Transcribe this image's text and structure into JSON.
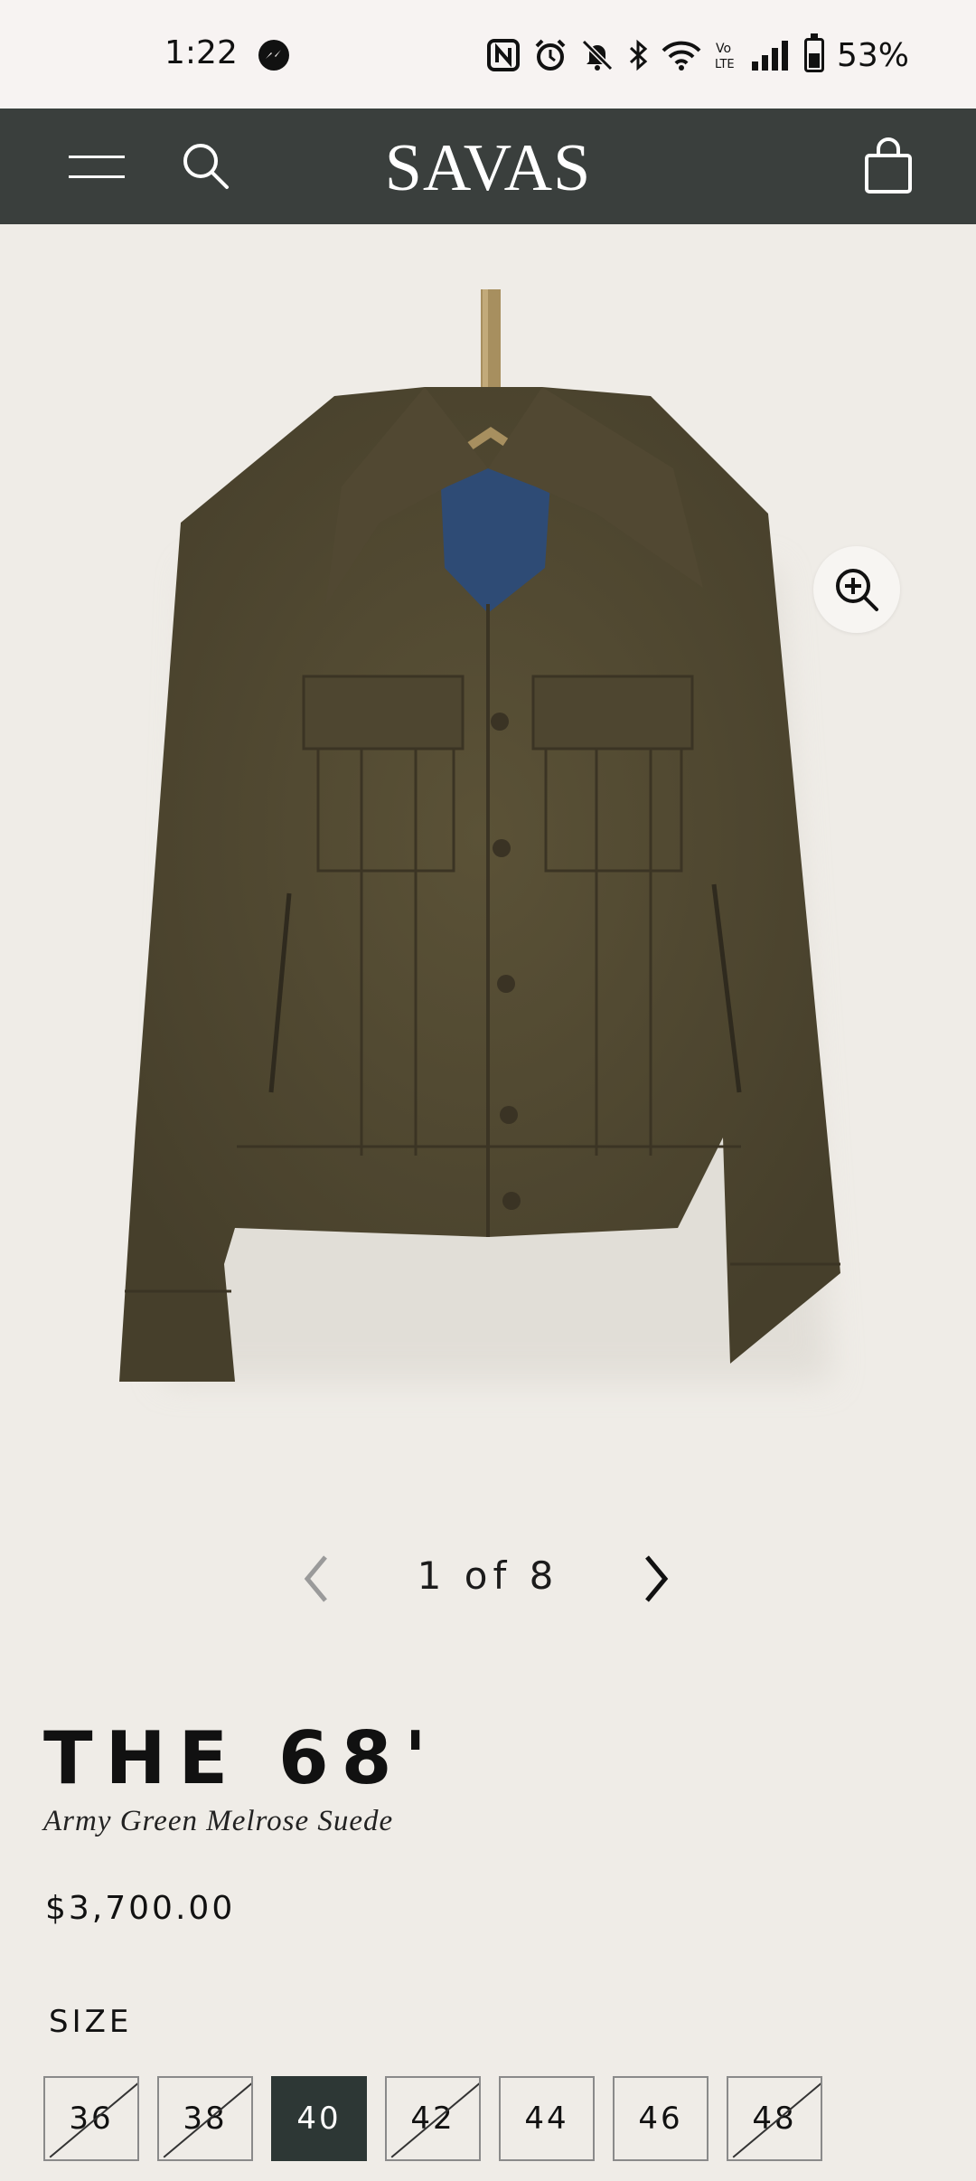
{
  "status_bar": {
    "time": "1:22",
    "battery": "53%",
    "battery_level": 0.53,
    "icons": [
      "messenger-icon",
      "nfc-icon",
      "alarm-icon",
      "bell-off-icon",
      "bluetooth-icon",
      "wifi-icon",
      "volte-icon",
      "signal-icon",
      "battery-icon"
    ]
  },
  "nav": {
    "logo": "SAVAS",
    "icons": [
      "menu-icon",
      "search-icon",
      "shopping-bag-icon"
    ],
    "background": "#3a3f3d"
  },
  "gallery": {
    "current": 1,
    "total": 8,
    "counter": "1 of 8",
    "image_description_icon": "jacket-image"
  },
  "product": {
    "title": "THE 68'",
    "subtitle": "Army Green Melrose Suede",
    "price": "$3,700.00"
  },
  "sizes": {
    "label": "SIZE",
    "options": [
      {
        "value": "36",
        "available": false
      },
      {
        "value": "38",
        "available": false
      },
      {
        "value": "40",
        "available": true,
        "selected": true
      },
      {
        "value": "42",
        "available": false
      },
      {
        "value": "44",
        "available": true
      },
      {
        "value": "46",
        "available": true
      },
      {
        "value": "48",
        "available": false
      }
    ],
    "selected_color": "#2d3735"
  }
}
